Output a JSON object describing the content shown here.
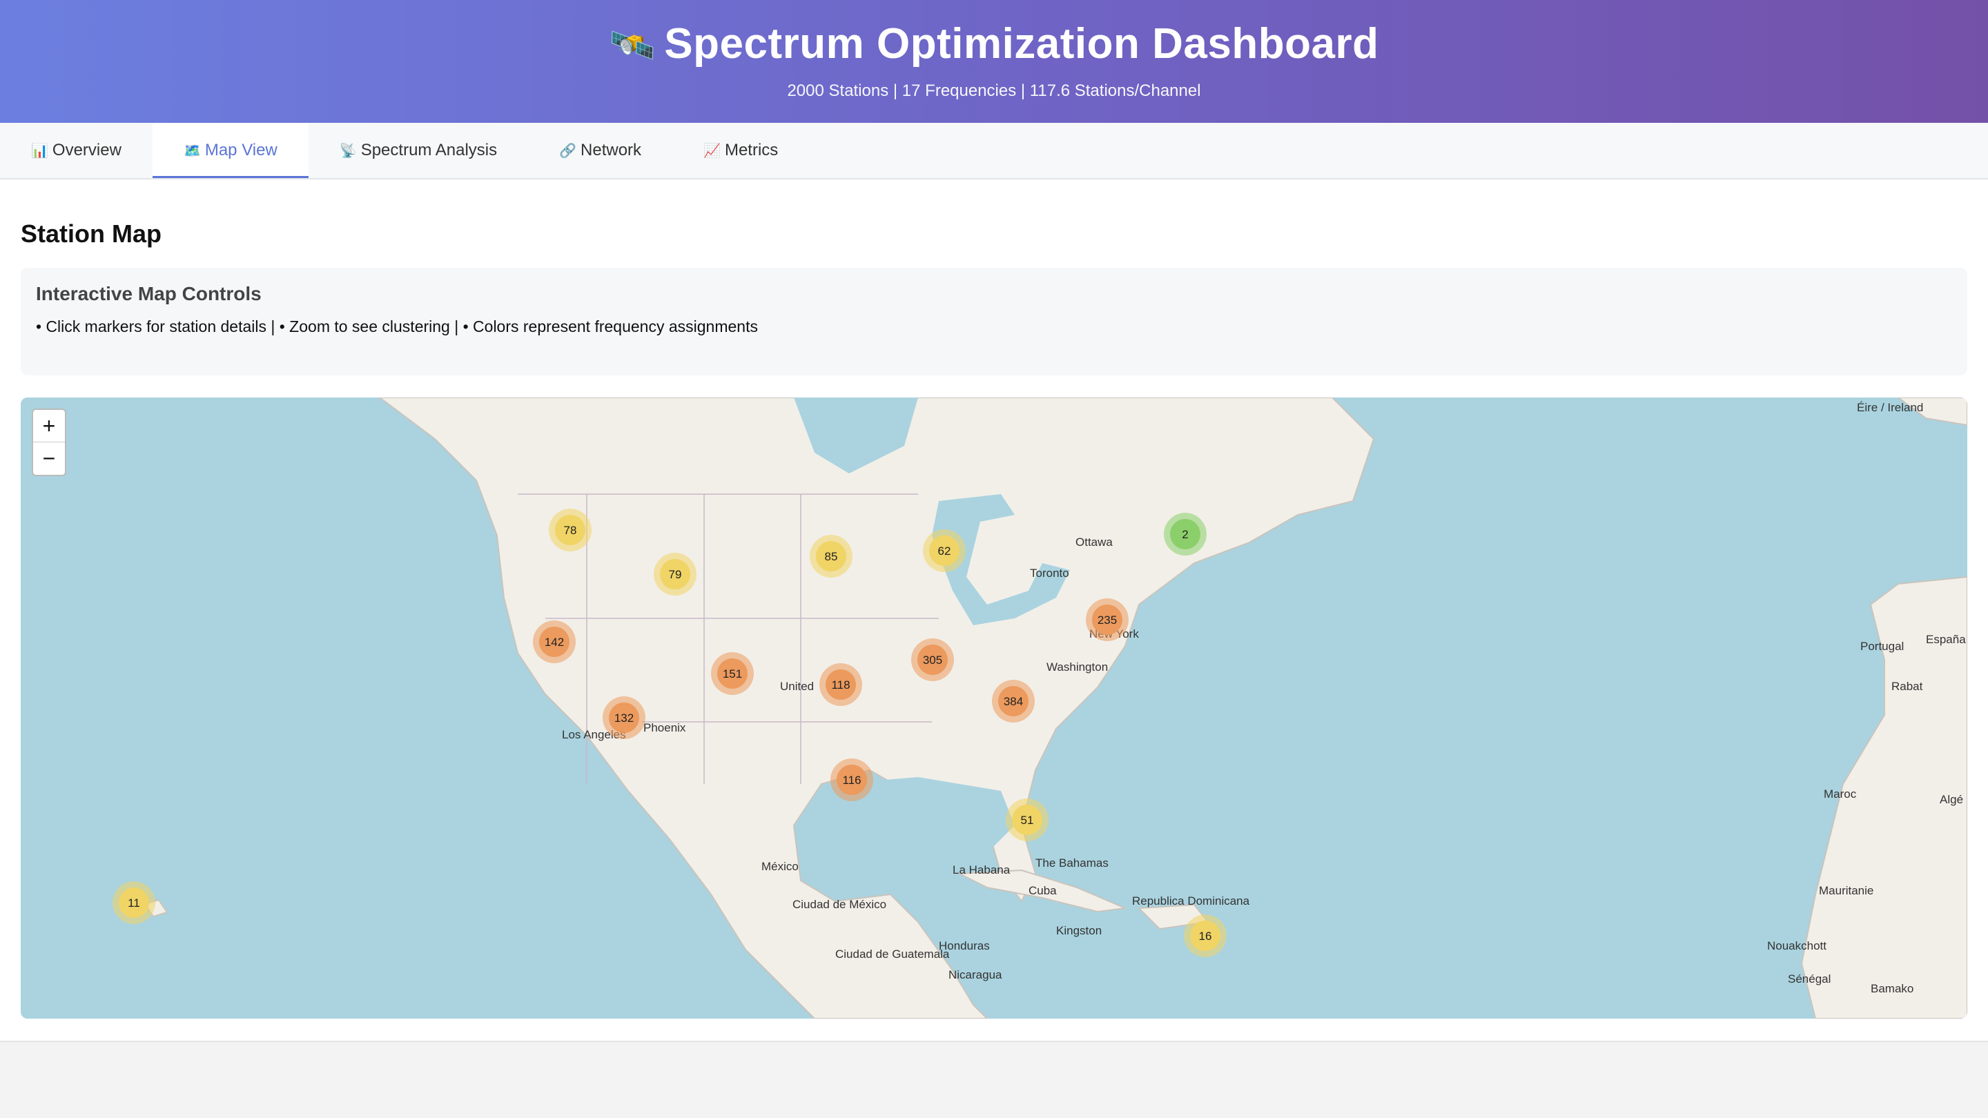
{
  "header": {
    "icon": "satellite-icon",
    "title": "Spectrum Optimization Dashboard",
    "subtitle": "2000 Stations | 17 Frequencies | 117.6 Stations/Channel"
  },
  "tabs": [
    {
      "icon": "bar-chart-icon",
      "label": "Overview",
      "active": false
    },
    {
      "icon": "map-icon",
      "label": "Map View",
      "active": true
    },
    {
      "icon": "satellite-dish-icon",
      "label": "Spectrum Analysis",
      "active": false
    },
    {
      "icon": "link-icon",
      "label": "Network",
      "active": false
    },
    {
      "icon": "trend-chart-icon",
      "label": "Metrics",
      "active": false
    }
  ],
  "page": {
    "title": "Station Map",
    "controls": {
      "title": "Interactive Map Controls",
      "text": "• Click markers for station details | • Zoom to see clustering | • Colors represent frequency assignments"
    }
  },
  "map": {
    "zoom_in": "+",
    "zoom_out": "−",
    "place_labels": [
      "Éire / Ireland",
      "Ottawa",
      "Toronto",
      "New York",
      "Washington",
      "United",
      "Phoenix",
      "Los Angeles",
      "México",
      "Ciudad de México",
      "La Habana",
      "Cuba",
      "The Bahamas",
      "Republica Dominicana",
      "Kingston",
      "Honduras",
      "Ciudad de Guatemala",
      "Nicaragua",
      "Portugal",
      "España",
      "Rabat",
      "Maroc",
      "Algé",
      "Mauritanie",
      "Nouakchott",
      "Sénégal",
      "Bamako"
    ],
    "clusters": [
      "78",
      "79",
      "85",
      "62",
      "2",
      "142",
      "151",
      "118",
      "305",
      "235",
      "384",
      "132",
      "116",
      "51",
      "11",
      "16"
    ],
    "cluster_colors": {
      "small": "#f0d465",
      "medium": "#ec9a5d",
      "tiny": "#8bcf6a"
    }
  }
}
